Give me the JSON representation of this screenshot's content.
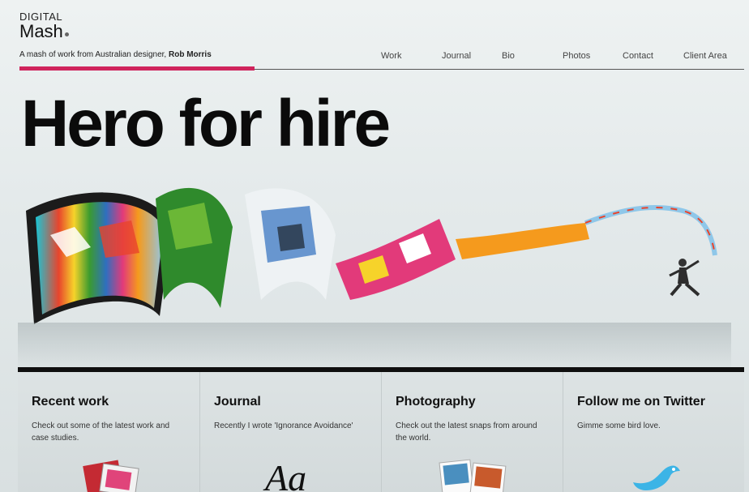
{
  "logo": {
    "line1": "DIGITAL",
    "line2": "Mash"
  },
  "tagline": {
    "prefix": "A mash of work from Australian designer, ",
    "name": "Rob Morris"
  },
  "nav": [
    "Work",
    "Journal",
    "Bio",
    "Photos",
    "Contact",
    "Client Area"
  ],
  "hero": {
    "title": "Hero for hire"
  },
  "sections": [
    {
      "title": "Recent work",
      "text": "Check out some of the latest work and case studies.",
      "icon": "stacked-photos-icon"
    },
    {
      "title": "Journal",
      "text": "Recently I wrote 'Ignorance Avoidance'",
      "icon": "script-aa-icon"
    },
    {
      "title": "Photography",
      "text": "Check out the latest snaps from around the world.",
      "icon": "polaroid-photos-icon"
    },
    {
      "title": "Follow me on Twitter",
      "text": "Gimme some bird love.",
      "icon": "twitter-bird-icon"
    }
  ],
  "colors": {
    "accent": "#d0245c",
    "text": "#111111",
    "background": "#e3e9ea"
  }
}
